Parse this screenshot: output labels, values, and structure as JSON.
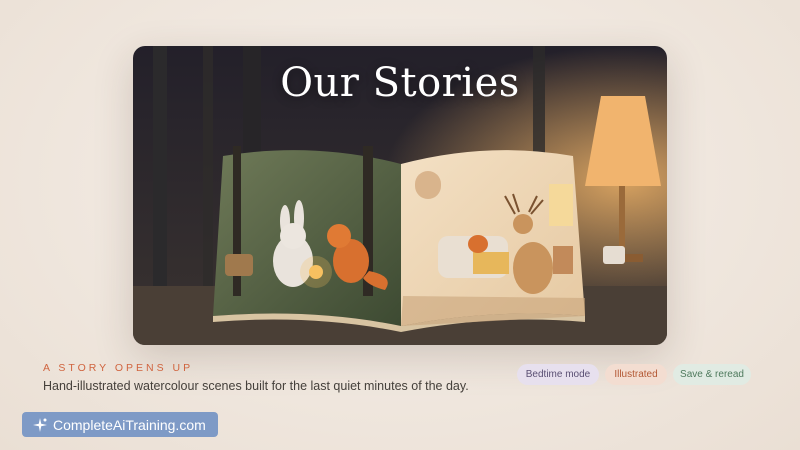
{
  "hero": {
    "title": "Our Stories"
  },
  "section": {
    "eyebrow": "A STORY OPENS UP",
    "description": "Hand-illustrated watercolour scenes built for the last quiet minutes of the day."
  },
  "tags": [
    {
      "label": "Bedtime mode",
      "color": "#5a4f73"
    },
    {
      "label": "Illustrated",
      "color": "#b35834"
    },
    {
      "label": "Save & reread",
      "color": "#4f7a5d"
    }
  ],
  "brand": {
    "label": "CompleteAiTraining.com",
    "icon": "sparkle-logo-icon"
  },
  "colors": {
    "accent": "#d0643f",
    "brand_badge": "#7e9ac6"
  }
}
